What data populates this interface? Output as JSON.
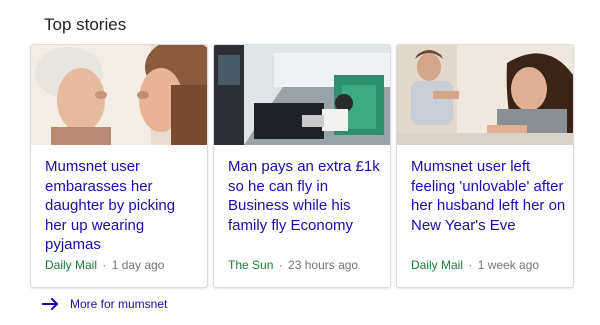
{
  "section": {
    "title": "Top stories"
  },
  "cards": [
    {
      "headline": "Mumsnet user embarasses her daughter by picking her up wearing pyjamas",
      "source": "Daily Mail",
      "time": "1 day ago"
    },
    {
      "headline": "Man pays an extra £1k so he can fly in Business while his family fly Economy",
      "source": "The Sun",
      "time": "23 hours ago"
    },
    {
      "headline": "Mumsnet user left feeling 'unlovable' after her husband left her on New Year's Eve",
      "source": "Daily Mail",
      "time": "1 week ago"
    }
  ],
  "more": {
    "label": "More for mumsnet"
  },
  "colors": {
    "link": "#1a0dab",
    "source": "#188038",
    "meta": "#70757a"
  }
}
